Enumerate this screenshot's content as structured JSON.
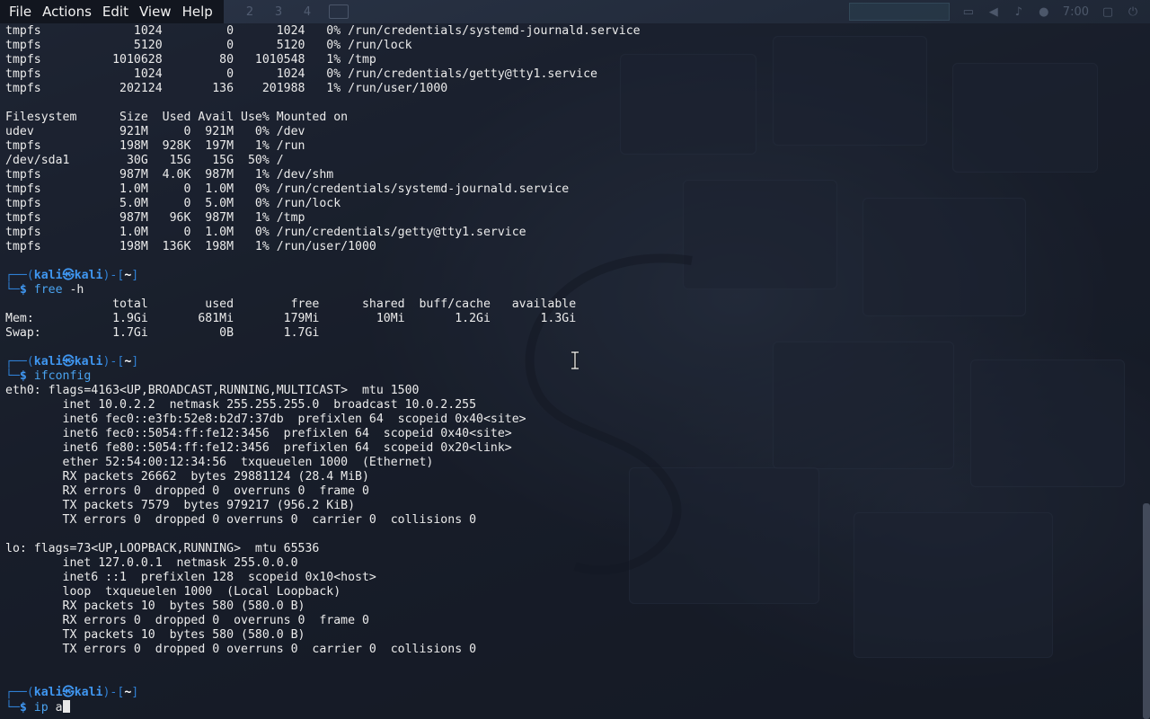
{
  "menu": {
    "items": [
      "File",
      "Actions",
      "Edit",
      "View",
      "Help"
    ]
  },
  "panel": {
    "workspaces": [
      "2",
      "3",
      "4"
    ],
    "clock": "7:00",
    "tray_icons": [
      "display-icon",
      "volume-icon",
      "notification-bell-icon",
      "network-icon",
      "lock-icon",
      "power-icon"
    ]
  },
  "colors": {
    "prompt_frame": "#2f7fd3",
    "prompt_user": "#3f96f0",
    "command": "#4aa3f0",
    "text": "#ebebeb"
  },
  "terminal": {
    "df_tail": [
      "tmpfs             1024         0      1024   0% /run/credentials/systemd-journald.service",
      "tmpfs             5120         0      5120   0% /run/lock",
      "tmpfs          1010628        80   1010548   1% /tmp",
      "tmpfs             1024         0      1024   0% /run/credentials/getty@tty1.service",
      "tmpfs           202124       136    201988   1% /run/user/1000"
    ],
    "df_h": [
      "Filesystem      Size  Used Avail Use% Mounted on",
      "udev            921M     0  921M   0% /dev",
      "tmpfs           198M  928K  197M   1% /run",
      "/dev/sda1        30G   15G   15G  50% /",
      "tmpfs           987M  4.0K  987M   1% /dev/shm",
      "tmpfs           1.0M     0  1.0M   0% /run/credentials/systemd-journald.service",
      "tmpfs           5.0M     0  5.0M   0% /run/lock",
      "tmpfs           987M   96K  987M   1% /tmp",
      "tmpfs           1.0M     0  1.0M   0% /run/credentials/getty@tty1.service",
      "tmpfs           198M  136K  198M   1% /run/user/1000"
    ],
    "prompt": {
      "frame_top_left": "┌──(",
      "user": "kali",
      "at": "㉿",
      "host": "kali",
      "frame_mid": ")-[",
      "dir": "~",
      "frame_end": "]",
      "frame_bottom": "└─",
      "dollar": "$ "
    },
    "cmd_free": {
      "name": "free",
      "args": " -h"
    },
    "free_output": [
      "               total        used        free      shared  buff/cache   available",
      "Mem:           1.9Gi       681Mi       179Mi        10Mi       1.2Gi       1.3Gi",
      "Swap:          1.7Gi          0B       1.7Gi"
    ],
    "cmd_ifconfig": {
      "name": "ifconfig",
      "args": ""
    },
    "ifconfig_output": [
      "eth0: flags=4163<UP,BROADCAST,RUNNING,MULTICAST>  mtu 1500",
      "        inet 10.0.2.2  netmask 255.255.255.0  broadcast 10.0.2.255",
      "        inet6 fec0::e3fb:52e8:b2d7:37db  prefixlen 64  scopeid 0x40<site>",
      "        inet6 fec0::5054:ff:fe12:3456  prefixlen 64  scopeid 0x40<site>",
      "        inet6 fe80::5054:ff:fe12:3456  prefixlen 64  scopeid 0x20<link>",
      "        ether 52:54:00:12:34:56  txqueuelen 1000  (Ethernet)",
      "        RX packets 26662  bytes 29881124 (28.4 MiB)",
      "        RX errors 0  dropped 0  overruns 0  frame 0",
      "        TX packets 7579  bytes 979217 (956.2 KiB)",
      "        TX errors 0  dropped 0 overruns 0  carrier 0  collisions 0",
      "",
      "lo: flags=73<UP,LOOPBACK,RUNNING>  mtu 65536",
      "        inet 127.0.0.1  netmask 255.0.0.0",
      "        inet6 ::1  prefixlen 128  scopeid 0x10<host>",
      "        loop  txqueuelen 1000  (Local Loopback)",
      "        RX packets 10  bytes 580 (580.0 B)",
      "        RX errors 0  dropped 0  overruns 0  frame 0",
      "        TX packets 10  bytes 580 (580.0 B)",
      "        TX errors 0  dropped 0 overruns 0  carrier 0  collisions 0"
    ],
    "cmd_current": {
      "name": "ip",
      "args": " a"
    }
  }
}
